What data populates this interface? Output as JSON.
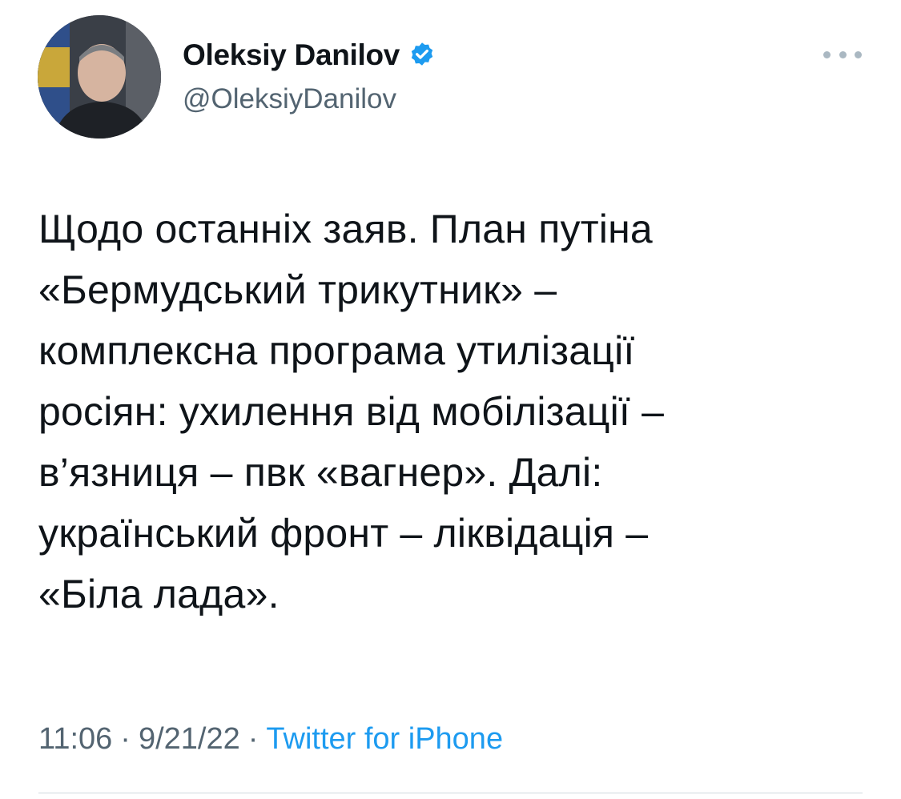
{
  "user": {
    "display_name": "Oleksiy Danilov",
    "handle": "@OleksiyDanilov",
    "verified": true,
    "avatar_icon": "profile-photo"
  },
  "tweet": {
    "lines": [
      "Щодо останніх заяв. План путіна",
      "«Бермудський трикутник» –",
      "комплексна програма утилізації",
      "росіян: ухилення від мобілізації –",
      "в’язниця – пвк «вагнер». Далі:",
      "український фронт – ліквідація –",
      "«Біла лада»."
    ]
  },
  "meta": {
    "time": "11:06",
    "date": "9/21/22",
    "separator": "·",
    "source": "Twitter for iPhone"
  },
  "icons": {
    "more": "more-dots-icon",
    "verified": "verified-badge-icon"
  },
  "colors": {
    "text": "#0f1419",
    "secondary": "#536471",
    "link": "#1d9bf0",
    "verified": "#1d9bf0"
  }
}
